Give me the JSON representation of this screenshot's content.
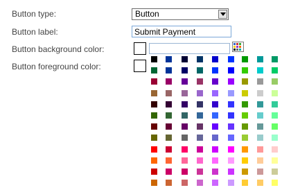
{
  "form": {
    "type_label": "Button type:",
    "type_value": "Button",
    "label_label": "Button label:",
    "label_value": "Submit Payment",
    "bg_label": "Button background color:",
    "fg_label": "Button foreground color:",
    "bg_value": "",
    "fg_value": ""
  },
  "icons": {
    "select_arrow": "chevron-down-icon",
    "palette_button": "color-palette-icon"
  },
  "palette": {
    "rows": [
      [
        "#000000",
        "#003399",
        "#000033",
        "#003366",
        "#0000cc",
        "#0033ff",
        "#009900",
        "#009999",
        "#009966"
      ],
      [
        "#006633",
        "#003399",
        "#000066",
        "#006666",
        "#0033ff",
        "#0000ff",
        "#33cc00",
        "#00cccc",
        "#00cc66"
      ],
      [
        "#990033",
        "#990066",
        "#660099",
        "#993366",
        "#6600cc",
        "#9900ff",
        "#999900",
        "#999999",
        "#99cc66"
      ],
      [
        "#996633",
        "#996666",
        "#996699",
        "#9966cc",
        "#9966ff",
        "#9999ff",
        "#cccc00",
        "#cccccc",
        "#ccff99"
      ],
      [
        "#330000",
        "#330033",
        "#330066",
        "#333366",
        "#3300cc",
        "#3333ff",
        "#339900",
        "#339999",
        "#33cc99"
      ],
      [
        "#336600",
        "#336633",
        "#336666",
        "#336699",
        "#3366ff",
        "#3333ff",
        "#66cc00",
        "#66cccc",
        "#66ff99"
      ],
      [
        "#660000",
        "#660033",
        "#660066",
        "#663366",
        "#6600ff",
        "#6633ff",
        "#669900",
        "#669999",
        "#66ff66"
      ],
      [
        "#666600",
        "#666633",
        "#666666",
        "#666699",
        "#6666cc",
        "#6666ff",
        "#99cc33",
        "#99cccc",
        "#99ffcc"
      ],
      [
        "#ff0000",
        "#cc0033",
        "#ff0066",
        "#cc0099",
        "#cc00ff",
        "#ff00ff",
        "#ff9900",
        "#ff9999",
        "#ffcccc"
      ],
      [
        "#ff6600",
        "#ff6633",
        "#ff6699",
        "#ff66cc",
        "#ff66ff",
        "#ff99ff",
        "#ffcc00",
        "#ffcc99",
        "#ffff99"
      ],
      [
        "#cc0000",
        "#cc0066",
        "#cc0066",
        "#cc3399",
        "#cc33cc",
        "#cc33ff",
        "#cc9900",
        "#cc9999",
        "#cccc99"
      ],
      [
        "#cc6600",
        "#cc6633",
        "#cc6666",
        "#cc66cc",
        "#cc66ff",
        "#cc99ff",
        "#ffcc33",
        "#ffcc66",
        "#ffff66"
      ]
    ]
  }
}
